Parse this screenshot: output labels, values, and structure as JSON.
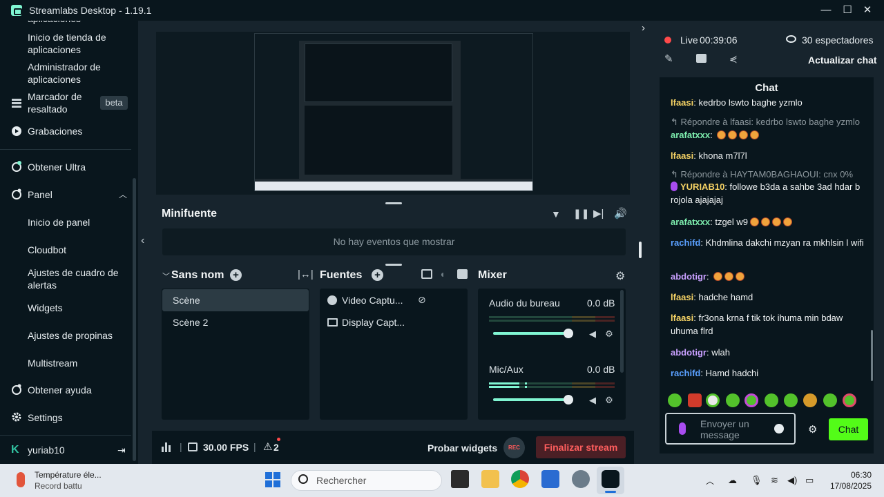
{
  "window": {
    "title": "Streamlabs Desktop - 1.19.1",
    "min": "—",
    "max": "☐",
    "close": "✕"
  },
  "sidebar": {
    "items": [
      {
        "label": "aplicaciones"
      },
      {
        "label": "Inicio de tienda de aplicaciones"
      },
      {
        "label": "Administrador de aplicaciones"
      },
      {
        "label": "Marcador de resaltado",
        "badge": "beta"
      },
      {
        "label": "Grabaciones"
      },
      {
        "label": "Obtener Ultra"
      },
      {
        "label": "Panel"
      },
      {
        "label": "Inicio de panel"
      },
      {
        "label": "Cloudbot"
      },
      {
        "label": "Ajustes de cuadro de alertas"
      },
      {
        "label": "Widgets"
      },
      {
        "label": "Ajustes de propinas"
      },
      {
        "label": "Multistream"
      },
      {
        "label": "Obtener ayuda"
      },
      {
        "label": "Settings"
      }
    ],
    "user": "yuriab10"
  },
  "minifuente": {
    "title": "Minifuente",
    "empty": "No hay eventos que mostrar"
  },
  "scenes": {
    "title": "Sans nom",
    "items": [
      "Scène",
      "Scène 2"
    ]
  },
  "sources": {
    "title": "Fuentes",
    "items": [
      "Video Captu...",
      "Display Capt..."
    ]
  },
  "mixer": {
    "title": "Mixer",
    "channels": [
      {
        "name": "Audio du bureau",
        "level": "0.0 dB"
      },
      {
        "name": "Mic/Aux",
        "level": "0.0 dB"
      }
    ]
  },
  "bottom": {
    "fps": "30.00 FPS",
    "alerts": "2",
    "test_widgets": "Probar widgets",
    "rec": "REC",
    "end_stream": "Finalizar stream"
  },
  "stream": {
    "live": "Live",
    "time": "00:39:06",
    "viewers": "30 espectadores",
    "refresh_chat": "Actualizar chat"
  },
  "chat": {
    "title": "Chat",
    "messages": [
      {
        "type": "msg",
        "user": "Ifaasi",
        "text": "kedrbo lswto baghe yzmlo",
        "color": "#f6d365"
      },
      {
        "type": "reply",
        "text": "Répondre à lfaasi: kedrbo lswto baghe yzmlo"
      },
      {
        "type": "msg",
        "user": "arafatxxx",
        "text": "",
        "emotes": 4,
        "color": "#7ff0b0"
      },
      {
        "type": "msg",
        "user": "lfaasi",
        "text": "khona m7l7l",
        "color": "#f6d365"
      },
      {
        "type": "reply",
        "text": "Répondre à HAYTAM0BAGHAOUI: cnx 0%"
      },
      {
        "type": "msg",
        "user": "YURIAB10",
        "text": "followe b3da a sahbe 3ad hdar b rojola ajajajaj",
        "color": "#f6d365"
      },
      {
        "type": "msg",
        "user": "arafatxxx",
        "text": "tzgel w9",
        "emotes": 4,
        "color": "#7ff0b0"
      },
      {
        "type": "msg",
        "user": "rachifd",
        "text": "Khdmlina dakchi mzyan ra mkhlsin l wifi",
        "color": "#5aa0ff"
      },
      {
        "type": "msg",
        "user": "abdotigr",
        "text": "",
        "emotes": 3,
        "color": "#c9a0ff"
      },
      {
        "type": "msg",
        "user": "lfaasi",
        "text": "hadche hamd",
        "color": "#f6d365"
      },
      {
        "type": "msg",
        "user": "lfaasi",
        "text": "fr3ona krna f tik tok ihuma min bdaw uhuma flrd",
        "color": "#f6d365"
      },
      {
        "type": "msg",
        "user": "abdotigr",
        "text": "wlah",
        "color": "#c9a0ff"
      },
      {
        "type": "msg",
        "user": "rachifd",
        "text": "Hamd hadchi",
        "color": "#5aa0ff"
      }
    ],
    "input_placeholder": "Envoyer un message",
    "send": "Chat"
  },
  "taskbar": {
    "notif_title": "Température éle...",
    "notif_sub": "Record battu",
    "search": "Rechercher",
    "time": "06:30",
    "date": "17/08/2025"
  }
}
